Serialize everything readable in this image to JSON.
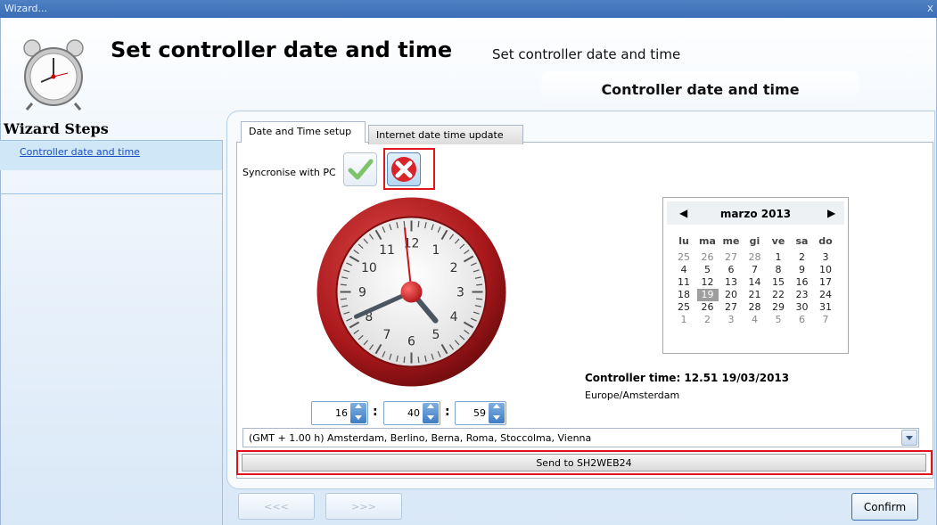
{
  "window": {
    "title": "Wizard...",
    "close_label": "x"
  },
  "header": {
    "title": "Set controller date and time",
    "subtitle": "Set controller date and time",
    "step_banner": "Controller date and time"
  },
  "sidebar": {
    "title": "Wizard Steps",
    "items": [
      {
        "label": "Controller date and time",
        "active": true
      }
    ]
  },
  "tabs": [
    {
      "label": "Date and Time setup",
      "active": true
    },
    {
      "label": "Internet date time update",
      "active": false
    }
  ],
  "sync": {
    "label": "Syncronise with PC"
  },
  "clock": {
    "numbers": [
      "12",
      "1",
      "2",
      "3",
      "4",
      "5",
      "6",
      "7",
      "8",
      "9",
      "10",
      "11"
    ],
    "hour": 4,
    "minute": 40,
    "second": 59
  },
  "calendar": {
    "month_label": "marzo 2013",
    "prev_icon": "◀",
    "next_icon": "▶",
    "weekdays": [
      "lu",
      "ma",
      "me",
      "gi",
      "ve",
      "sa",
      "do"
    ],
    "weeks": [
      [
        "25",
        "26",
        "27",
        "28",
        "1",
        "2",
        "3"
      ],
      [
        "4",
        "5",
        "6",
        "7",
        "8",
        "9",
        "10"
      ],
      [
        "11",
        "12",
        "13",
        "14",
        "15",
        "16",
        "17"
      ],
      [
        "18",
        "19",
        "20",
        "21",
        "22",
        "23",
        "24"
      ],
      [
        "25",
        "26",
        "27",
        "28",
        "29",
        "30",
        "31"
      ],
      [
        "1",
        "2",
        "3",
        "4",
        "5",
        "6",
        "7"
      ]
    ],
    "selected_day": "19"
  },
  "controller": {
    "time_text": "Controller time: 12.51  19/03/2013",
    "timezone": "Europe/Amsterdam"
  },
  "time_inputs": {
    "hours": "16",
    "minutes": "40",
    "seconds": "59",
    "separator": ":"
  },
  "timezone_select": {
    "value": "(GMT + 1.00 h) Amsterdam, Berlino, Berna, Roma, Stoccolma, Vienna"
  },
  "buttons": {
    "send": "Send to SH2WEB24",
    "prev": "<<<",
    "next": ">>>",
    "confirm": "Confirm"
  },
  "colors": {
    "highlight": "#e0141c",
    "title_bar": "#4f81c4",
    "link": "#1a4fc4"
  }
}
